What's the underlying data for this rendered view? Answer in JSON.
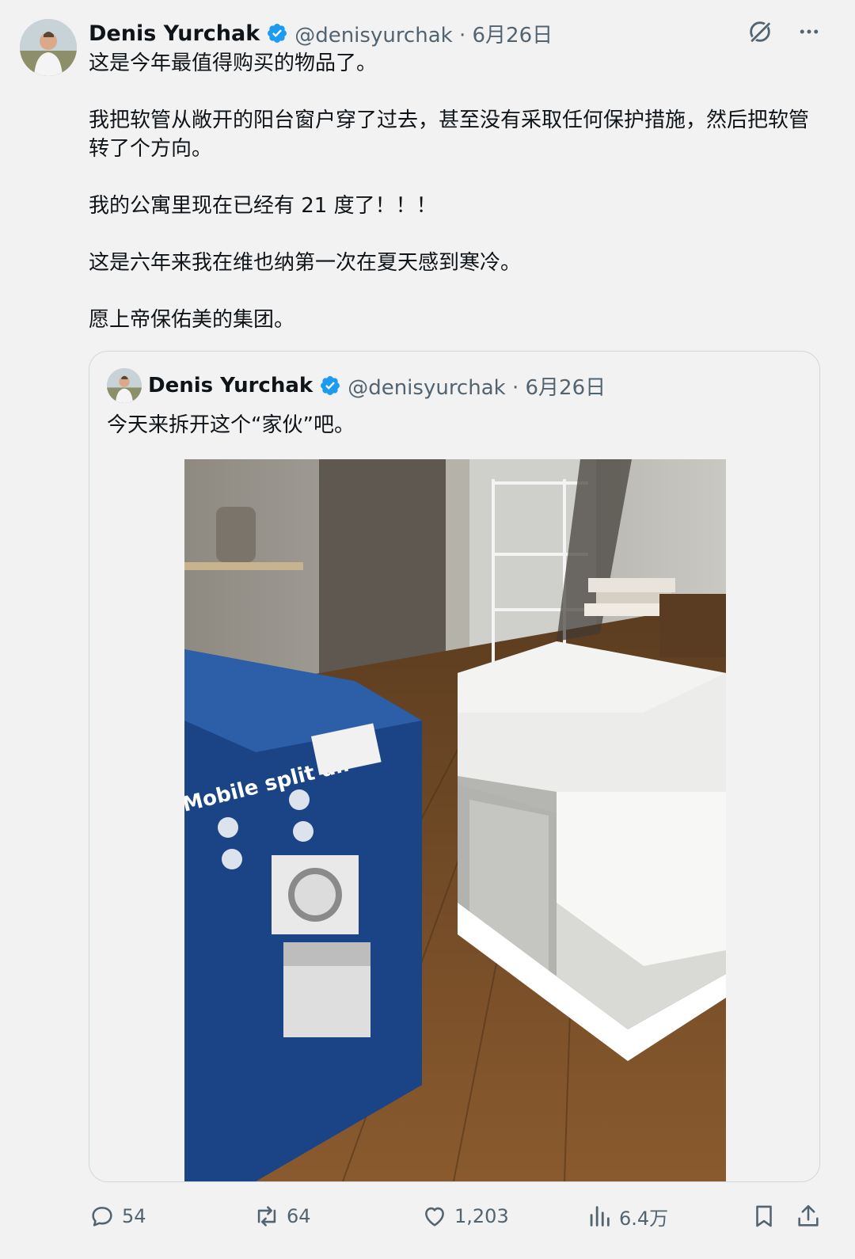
{
  "tweet": {
    "author_name": "Denis Yurchak",
    "handle_date": "@denisyurchak · 6月26日",
    "paragraphs": [
      "这是今年最值得购买的物品了。",
      "我把软管从敞开的阳台窗户穿了过去，甚至没有采取任何保护措施，然后把软管转了个方向。",
      "我的公寓里现在已经有 21 度了！！！",
      "这是六年来我在维也纳第一次在夏天感到寒冷。",
      "愿上帝保佑美的集团。"
    ]
  },
  "quote": {
    "author_name": "Denis Yurchak",
    "handle_date": "@denisyurchak · 6月26日",
    "text": "今天来拆开这个“家伙”吧。",
    "photo": {
      "box_printed_text": "Mobile split air"
    }
  },
  "actions": {
    "replies": "54",
    "reposts": "64",
    "likes": "1,203",
    "views": "6.4万"
  },
  "colors": {
    "background": "#f2f2f2",
    "text": "#0f1419",
    "secondary": "#536471",
    "verified": "#1d9bf0",
    "border": "#cfd9de"
  },
  "icons": [
    "verified-badge-icon",
    "grok-icon",
    "more-icon",
    "reply-icon",
    "repost-icon",
    "like-icon",
    "views-icon",
    "bookmark-icon",
    "share-icon"
  ]
}
